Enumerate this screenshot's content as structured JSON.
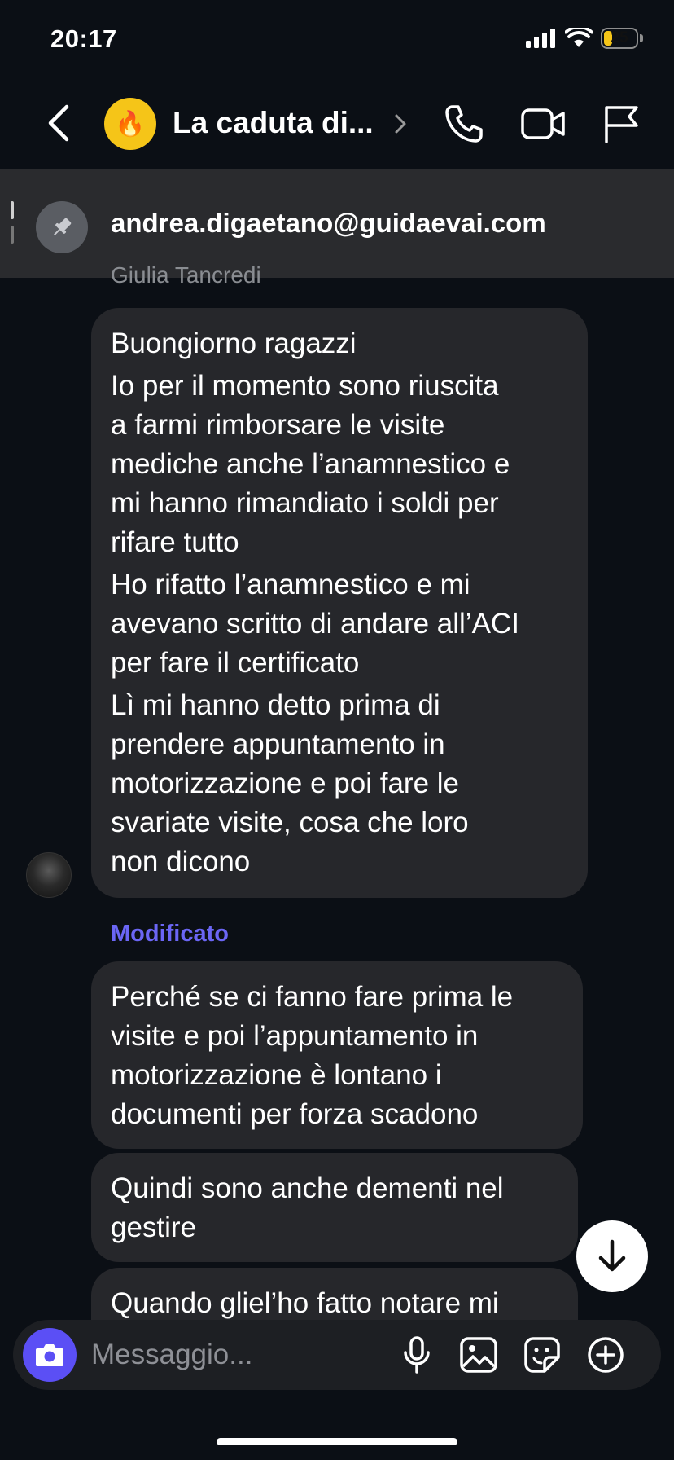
{
  "status_bar": {
    "time": "20:17",
    "battery": "25",
    "battery_level": 0.25
  },
  "header": {
    "group_emoji": "🔥",
    "title": "La caduta di...",
    "icons": [
      "chevron-left-icon",
      "chevron-right-icon",
      "phone-icon",
      "video-camera-icon",
      "flag-icon"
    ]
  },
  "pinned": {
    "text": "andrea.digaetano@guidaevai.com",
    "icon": "pin-icon"
  },
  "chat": {
    "sender_name": "Giulia Tancredi",
    "messages": [
      {
        "paragraphs": [
          [
            "Buongiorno ragazzi"
          ],
          [
            "Io per il momento sono riuscita",
            "a farmi rimborsare le visite",
            "mediche anche l’anamnestico e",
            "mi hanno rimandiato i soldi per",
            "rifare tutto"
          ],
          [
            "Ho rifatto l’anamnestico e mi",
            "avevano scritto di andare all’ACI",
            "per fare il certificato"
          ],
          [
            "Lì mi hanno detto prima di",
            "prendere appuntamento in",
            "motorizzazione e poi fare le",
            "svariate visite, cosa che loro",
            "non dicono"
          ]
        ]
      },
      {
        "lines": [
          "Perché se ci fanno fare prima le",
          "visite e poi l’appuntamento  in",
          "motorizzazione è lontano i",
          "documenti per forza scadono"
        ]
      },
      {
        "lines": [
          "Quindi sono anche dementi nel",
          "gestire"
        ]
      },
      {
        "lines": [
          "Quando gliel’ho fatto notare mi"
        ]
      }
    ],
    "edited_label": "Modificato"
  },
  "composer": {
    "placeholder": "Messaggio...",
    "icons": [
      "camera-icon",
      "microphone-icon",
      "gallery-icon",
      "sticker-icon",
      "plus-circle-icon"
    ]
  },
  "colors": {
    "background": "#0b0f15",
    "bubble": "#26272b",
    "accent": "#5b4ff5",
    "edited": "#6b66f5",
    "battery": "#f5c518"
  }
}
